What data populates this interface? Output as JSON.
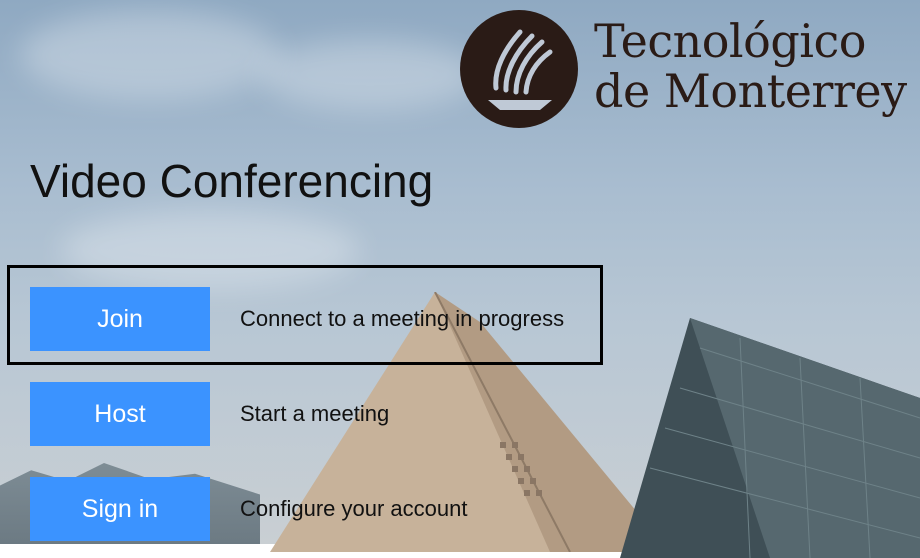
{
  "brand": {
    "line1": "Tecnológico",
    "line2": "de Monterrey"
  },
  "page": {
    "title": "Video Conferencing"
  },
  "actions": [
    {
      "label": "Join",
      "description": "Connect to a meeting in progress"
    },
    {
      "label": "Host",
      "description": "Start a meeting"
    },
    {
      "label": "Sign in",
      "description": "Configure your account"
    }
  ],
  "colors": {
    "button": "#3b93ff",
    "button_text": "#ffffff",
    "brand": "#2a1b16"
  }
}
